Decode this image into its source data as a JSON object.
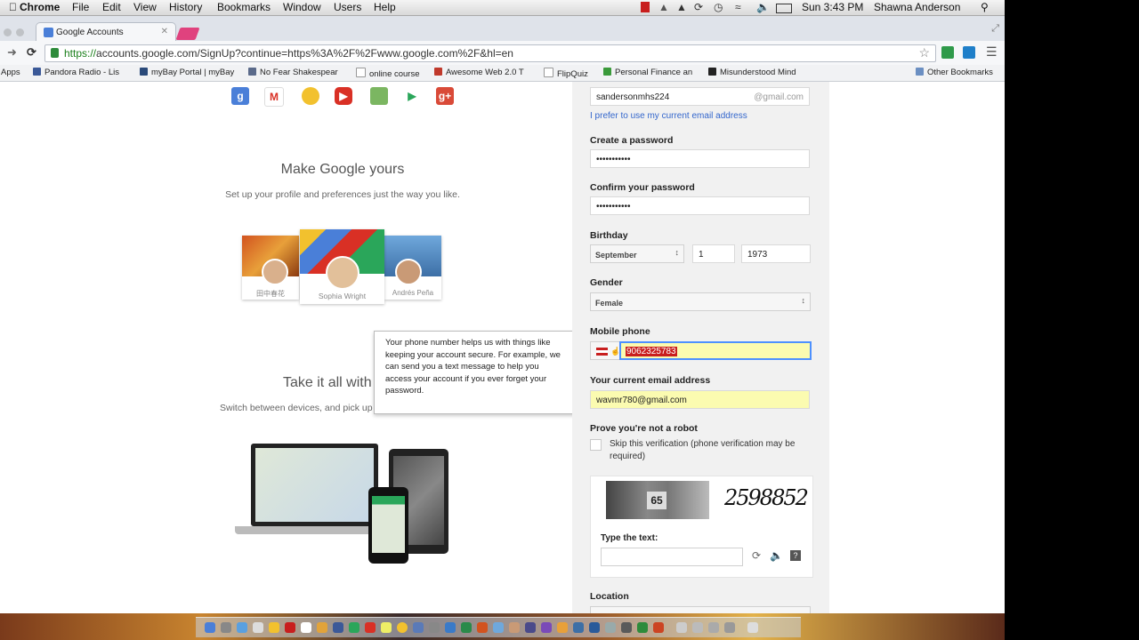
{
  "menubar": {
    "app": "Chrome",
    "items": [
      "File",
      "Edit",
      "View",
      "History",
      "Bookmarks",
      "Window",
      "Users",
      "Help"
    ],
    "clock": "Sun 3:43 PM",
    "user": "Shawna Anderson"
  },
  "tab": {
    "title": "Google Accounts"
  },
  "omnibox": {
    "scheme": "https://",
    "host": "accounts.google.com",
    "path": "/SignUp?continue=https%3A%2F%2Fwww.google.com%2F&hl=en"
  },
  "bookmarks": [
    "Apps",
    "Pandora Radio - Lis",
    "myBay Portal | myBay",
    "No Fear Shakespear",
    "online course",
    "Awesome Web 2.0 T",
    "FlipQuiz",
    "Personal Finance an",
    "Misunderstood Mind",
    "Other Bookmarks"
  ],
  "promo": {
    "heading1": "Make Google yours",
    "sub1": "Set up your profile and preferences just the way you like.",
    "card_names": [
      "田中春花",
      "Sophia Wright",
      "Andrés Peña"
    ],
    "heading2": "Take it all with",
    "sub2": "Switch between devices, and pick up"
  },
  "tooltip": "Your phone number helps us with things like keeping your account secure. For example, we can send you a text message to help you access your account if you ever forget your password.",
  "form": {
    "username": "sandersonmhs224",
    "gmail_suffix": "@gmail.com",
    "use_current_email_link": "I prefer to use my current email address",
    "password_label": "Create a password",
    "password_value": "•••••••••••",
    "confirm_label": "Confirm your password",
    "confirm_value": "•••••••••••",
    "birthday_label": "Birthday",
    "birth_month": "September",
    "birth_day": "1",
    "birth_year": "1973",
    "gender_label": "Gender",
    "gender_value": "Female",
    "mobile_label": "Mobile phone",
    "mobile_value": "9062325783",
    "current_email_label": "Your current email address",
    "current_email_value": "wavmr780@gmail.com",
    "robot_label": "Prove you're not a robot",
    "skip_label": "Skip this verification (phone verification may be required)",
    "captcha_number": "65",
    "captcha_word": "2598852",
    "type_text_label": "Type the text:",
    "location_label": "Location"
  }
}
